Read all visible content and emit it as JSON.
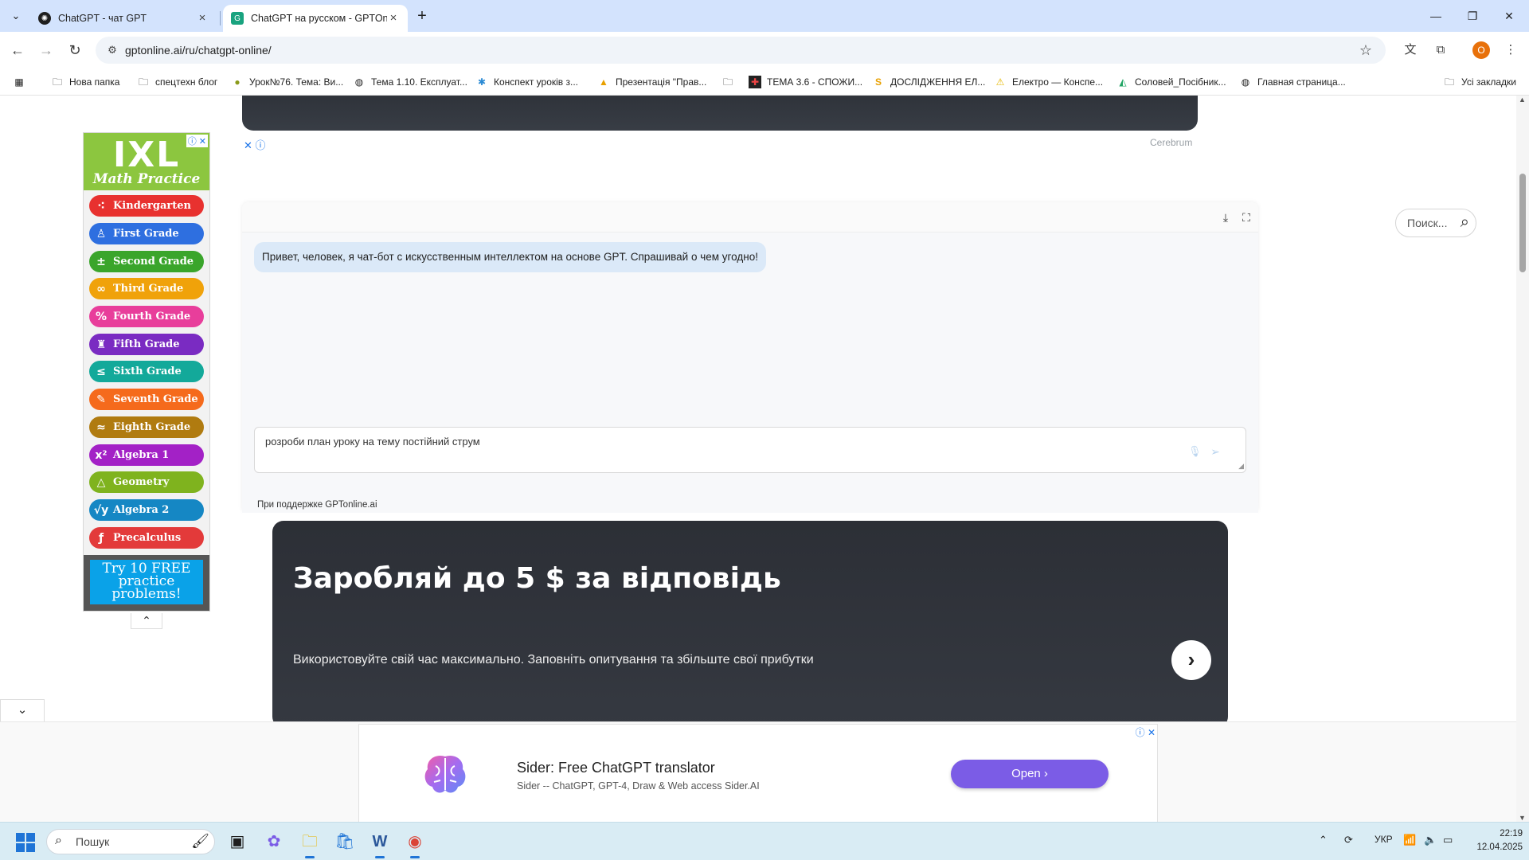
{
  "browser": {
    "tabs": [
      {
        "title": "ChatGPT - чат GPT",
        "active": false
      },
      {
        "title": "ChatGPT на русском - GPTOnline",
        "active": true
      }
    ],
    "url": "gptonline.ai/ru/chatgpt-online/",
    "profile_initial": "O",
    "bookmarks": [
      {
        "label": "Нова папка",
        "icon": "folder-icon"
      },
      {
        "label": "спецтехн блог",
        "icon": "folder-icon"
      },
      {
        "label": "Урок№76. Тема: Ви...",
        "icon": "site-icon"
      },
      {
        "label": "Тема 1.10. Експлуат...",
        "icon": "site-icon"
      },
      {
        "label": "Конспект уроків з...",
        "icon": "site-icon"
      },
      {
        "label": "Презентація \"Прав...",
        "icon": "site-icon"
      },
      {
        "label": "",
        "icon": "folder-icon"
      },
      {
        "label": "ТЕМА 3.6 - СПОЖИ...",
        "icon": "site-icon"
      },
      {
        "label": "ДОСЛІДЖЕННЯ ЕЛ...",
        "icon": "site-icon"
      },
      {
        "label": "Електро — Конспе...",
        "icon": "warning-icon"
      },
      {
        "label": "Соловей_Посібник...",
        "icon": "drive-icon"
      },
      {
        "label": "Главная страница...",
        "icon": "site-icon"
      }
    ],
    "all_bookmarks": "Усі закладки"
  },
  "ixl_ad": {
    "logo": "IXL",
    "subtitle": "Math Practice",
    "grades": [
      {
        "label": "Kindergarten",
        "icon": "⁖",
        "color": "#e8312f"
      },
      {
        "label": "First Grade",
        "icon": "♙",
        "color": "#2e6fe0"
      },
      {
        "label": "Second Grade",
        "icon": "±",
        "color": "#3aa52b"
      },
      {
        "label": "Third Grade",
        "icon": "∞",
        "color": "#f0a20a"
      },
      {
        "label": "Fourth Grade",
        "icon": "%",
        "color": "#e83e9b"
      },
      {
        "label": "Fifth Grade",
        "icon": "♜",
        "color": "#7a2bc2"
      },
      {
        "label": "Sixth Grade",
        "icon": "≤",
        "color": "#13a99a"
      },
      {
        "label": "Seventh Grade",
        "icon": "✎",
        "color": "#f56a1c"
      },
      {
        "label": "Eighth Grade",
        "icon": "≈",
        "color": "#b07b10"
      },
      {
        "label": "Algebra 1",
        "icon": "x²",
        "color": "#a321c6"
      },
      {
        "label": "Geometry",
        "icon": "△",
        "color": "#7fb31e"
      },
      {
        "label": "Algebra 2",
        "icon": "√y",
        "color": "#1587c4"
      },
      {
        "label": "Precalculus",
        "icon": "ƒ",
        "color": "#e33a3a"
      }
    ],
    "cta": "Try 10 FREE practice problems!"
  },
  "top_ad": {
    "provider": "Cerebrum"
  },
  "chat": {
    "greeting": "Привет, человек, я чат-бот с искусственным интеллектом на основе GPT. Спрашивай о чем угодно!",
    "input_value": "розроби план уроку на тему постійний струм",
    "powered_by": "При поддержке GPTonline.ai"
  },
  "promo": {
    "title": "Заробляй до 5 $ за відповідь",
    "subtitle": "Використовуйте свій час максимально. Заповніть опитування та збільште свої прибутки"
  },
  "search": {
    "placeholder": "Поиск..."
  },
  "bottom_ad": {
    "title": "Sider: Free ChatGPT translator",
    "subtitle": "Sider -- ChatGPT, GPT-4, Draw & Web access Sider.AI",
    "button": "Open"
  },
  "taskbar": {
    "search_label": "Пошук",
    "language": "УКР",
    "time": "22:19",
    "date": "12.04.2025"
  }
}
